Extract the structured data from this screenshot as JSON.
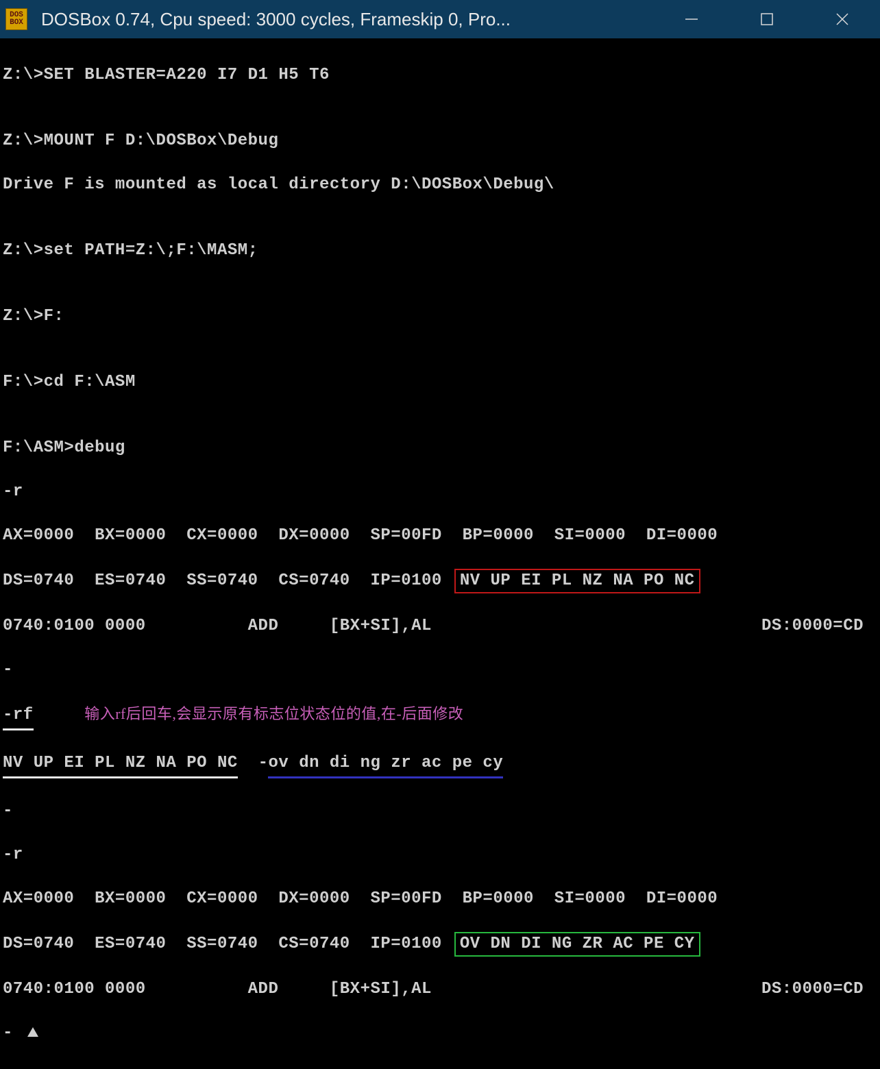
{
  "titlebar": {
    "icon_top": "DOS",
    "icon_bottom": "BOX",
    "title": "DOSBox 0.74, Cpu speed:    3000 cycles, Frameskip  0, Pro..."
  },
  "terminal": {
    "l1": "Z:\\>SET BLASTER=A220 I7 D1 H5 T6",
    "l2": "",
    "l3": "Z:\\>MOUNT F D:\\DOSBox\\Debug",
    "l4": "Drive F is mounted as local directory D:\\DOSBox\\Debug\\",
    "l5": "",
    "l6": "Z:\\>set PATH=Z:\\;F:\\MASM;",
    "l7": "",
    "l8": "Z:\\>F:",
    "l9": "",
    "l10": "F:\\>cd F:\\ASM",
    "l11": "",
    "l12": "F:\\ASM>debug",
    "l13": "-r",
    "reg_a": "AX=0000  BX=0000  CX=0000  DX=0000  SP=00FD  BP=0000  SI=0000  DI=0000",
    "seg_a_left": "DS=0740  ES=0740  SS=0740  CS=0740  IP=0100",
    "flags_a": "NV UP EI PL NZ NA PO NC",
    "dis_a_left": "0740:0100 0000          ADD     [BX+SI],AL",
    "dis_a_right": "DS:0000=CD",
    "dash1": "-",
    "rf_cmd": "-rf",
    "annotation": "输入rf后回车,会显示原有标志位状态位的值,在-后面修改",
    "flag_left": "NV UP EI PL NZ NA PO NC",
    "flag_mid": "  -",
    "flag_right": "ov dn di ng zr ac pe cy",
    "dash2": "-",
    "r2": "-r",
    "reg_b": "AX=0000  BX=0000  CX=0000  DX=0000  SP=00FD  BP=0000  SI=0000  DI=0000",
    "seg_b_left": "DS=0740  ES=0740  SS=0740  CS=0740  IP=0100",
    "flags_b": "OV DN DI NG ZR AC PE CY",
    "dis_b_left": "0740:0100 0000          ADD     [BX+SI],AL",
    "dis_b_right": "DS:0000=CD",
    "dash3": "- "
  }
}
